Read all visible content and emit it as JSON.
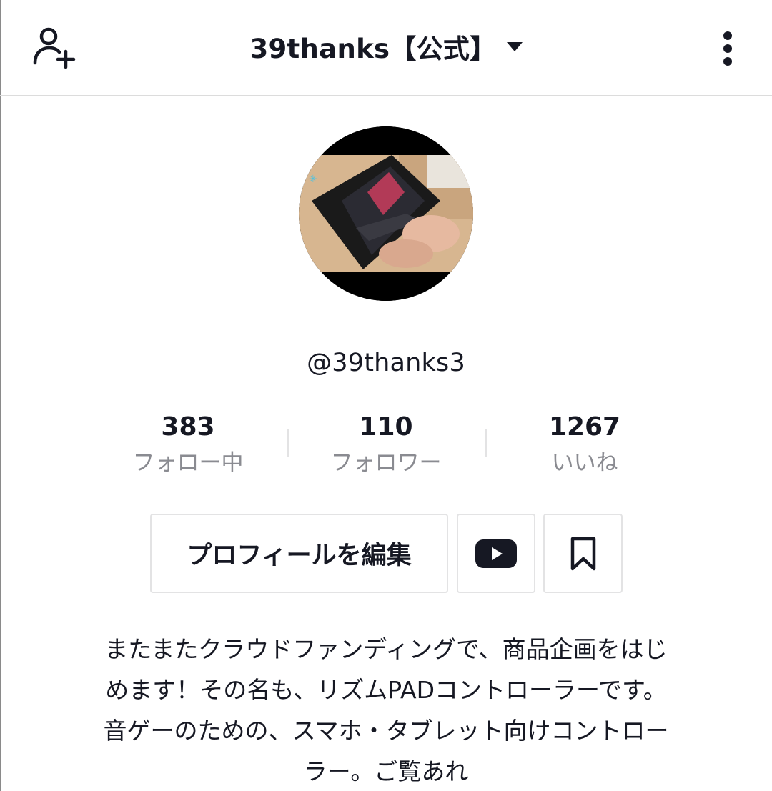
{
  "header": {
    "title": "39thanks【公式】",
    "add_user_icon": "person-plus-icon",
    "dropdown_icon": "caret-down-icon",
    "more_icon": "vertical-dots-icon"
  },
  "profile": {
    "avatar_icon": "avatar-photo-tablet-controller",
    "handle": "@39thanks3"
  },
  "stats": [
    {
      "value": "383",
      "label": "フォロー中"
    },
    {
      "value": "110",
      "label": "フォロワー"
    },
    {
      "value": "1267",
      "label": "いいね"
    }
  ],
  "actions": {
    "edit_profile_label": "プロフィールを編集",
    "youtube_icon": "youtube-icon",
    "bookmark_icon": "bookmark-icon"
  },
  "bio": {
    "lines": [
      "またまたクラウドファンディングで、商品企画をはじ",
      "めます！その名も、リズムPADコントローラーです。",
      "音ゲーのための、スマホ・タブレット向けコントロー",
      "ラー。ご覧あれ"
    ]
  },
  "colors": {
    "text": "#161823",
    "muted": "#8a8b91",
    "border": "#e3e3e4"
  }
}
